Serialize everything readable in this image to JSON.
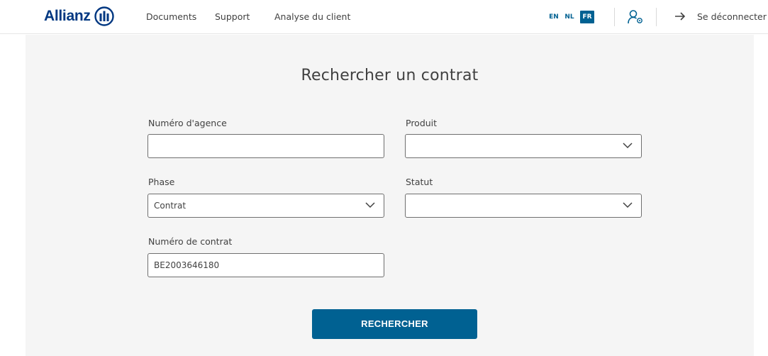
{
  "header": {
    "logo_text": "Allianz",
    "nav": {
      "documents": "Documents",
      "support": "Support",
      "analyse": "Analyse du client"
    },
    "languages": {
      "en": "EN",
      "nl": "NL",
      "fr": "FR",
      "active": "FR"
    },
    "logout_label": "Se déconnecter",
    "brand_color": "#003781",
    "accent_color": "#006192"
  },
  "main": {
    "title": "Rechercher un contrat",
    "fields": {
      "agence": {
        "label": "Numéro d'agence",
        "value": ""
      },
      "produit": {
        "label": "Produit",
        "value": ""
      },
      "phase": {
        "label": "Phase",
        "value": "Contrat"
      },
      "statut": {
        "label": "Statut",
        "value": ""
      },
      "contrat": {
        "label": "Numéro de contrat",
        "value": "BE2003646180"
      }
    },
    "search_button": "RECHERCHER"
  }
}
